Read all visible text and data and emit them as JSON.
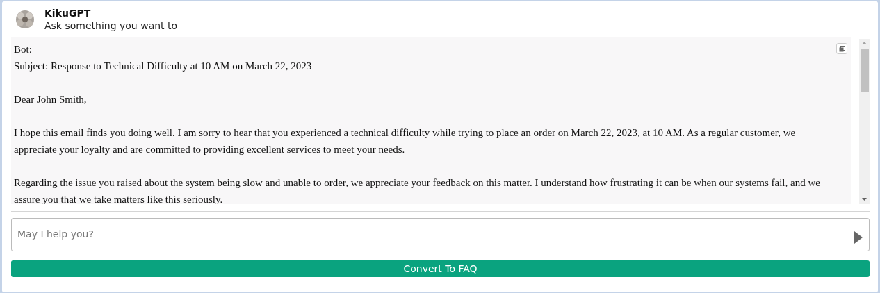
{
  "header": {
    "title": "KikuGPT",
    "subtitle": "Ask something you want to"
  },
  "messages": [
    {
      "sender": "Bot:",
      "paragraphs": [
        "Subject: Response to Technical Difficulty at 10 AM on March 22, 2023",
        "Dear John Smith,",
        "I hope this email finds you doing well. I am sorry to hear that you experienced a technical difficulty while trying to place an order on March 22, 2023, at 10 AM. As a regular customer, we appreciate your loyalty and are committed to providing excellent services to meet your needs.",
        "Regarding the issue you raised about the system being slow and unable to order, we appreciate your feedback on this matter. I understand how frustrating it can be when our systems fail, and we assure you that we take matters like this seriously."
      ]
    }
  ],
  "composer": {
    "placeholder": "May I help you?"
  },
  "convert_button": "Convert To FAQ"
}
